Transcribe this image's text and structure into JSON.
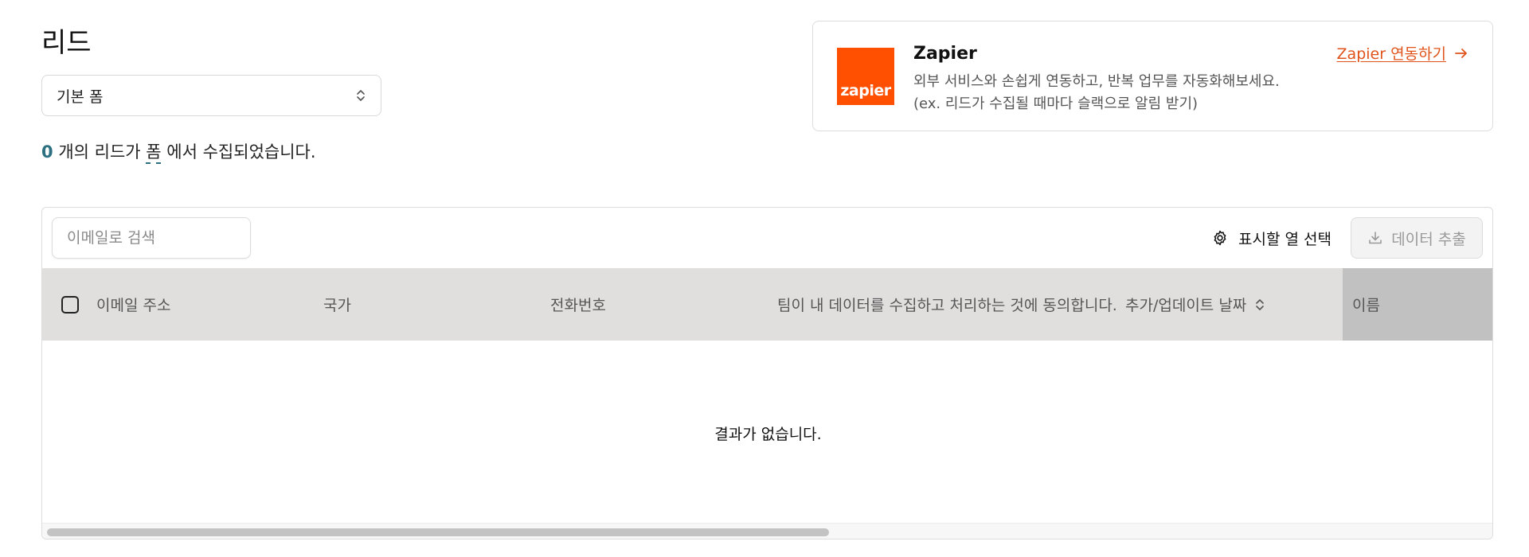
{
  "header": {
    "title": "리드",
    "form_select_value": "기본 폼",
    "summary": {
      "count": "0",
      "text_before": "개의 리드가",
      "form_link": "폼",
      "text_after": "에서 수집되었습니다."
    }
  },
  "zapier": {
    "logo_text": "zapier",
    "name": "Zapier",
    "desc_line1": "외부 서비스와 손쉽게 연동하고, 반복 업무를 자동화해보세요.",
    "desc_line2": "(ex. 리드가 수집될 때마다 슬랙으로 알림 받기)",
    "link_label": "Zapier 연동하기",
    "brand_color": "#ff4f00",
    "link_color": "#e0531b"
  },
  "toolbar": {
    "search_placeholder": "이메일로 검색",
    "columns_label": "표시할 열 선택",
    "export_label": "데이터 추출"
  },
  "table": {
    "columns": {
      "email": "이메일 주소",
      "country": "국가",
      "phone": "전화번호",
      "consent": "팀이 내 데이터를 수집하고 처리하는 것에 동의합니다.",
      "date": "추가/업데이트 날짜",
      "name": "이름"
    },
    "empty_message": "결과가 없습니다.",
    "rows": []
  },
  "colors": {
    "accent": "#2b6f80",
    "header_bg": "#e0dfde",
    "sticky_header_bg": "#c1c1c1"
  }
}
